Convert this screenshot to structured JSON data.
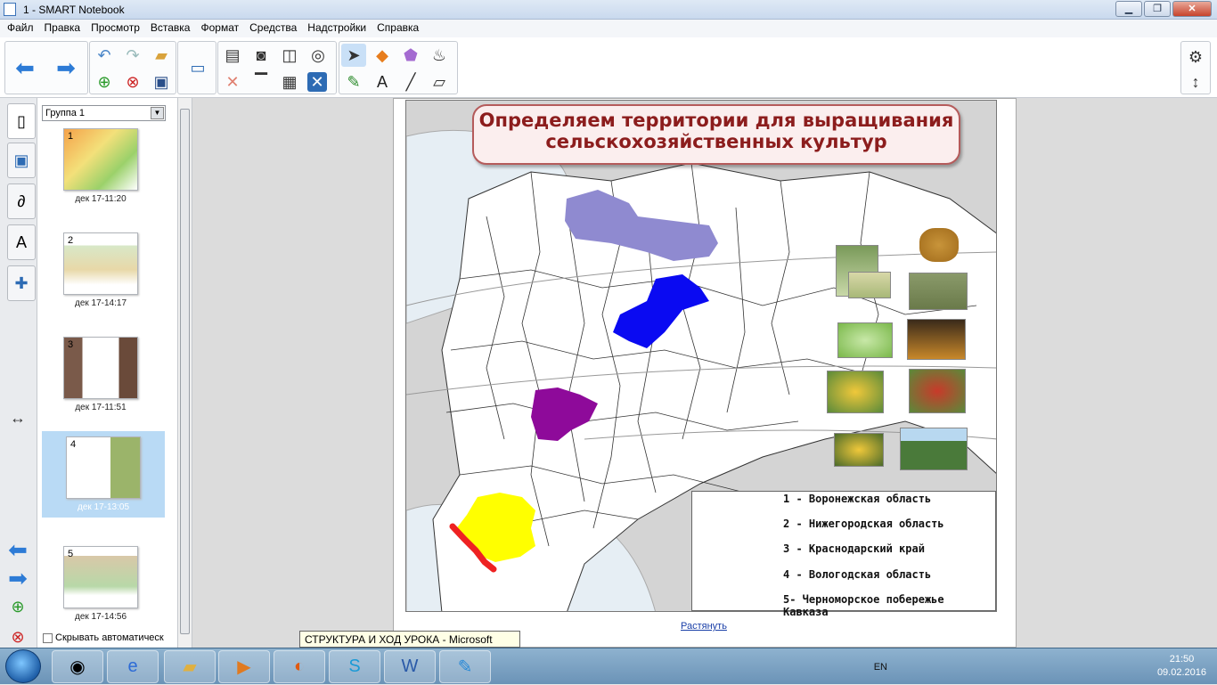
{
  "window": {
    "title": "1 - SMART Notebook",
    "min": "▁",
    "max": "❐",
    "close": "✕"
  },
  "menu": [
    "Файл",
    "Правка",
    "Просмотр",
    "Вставка",
    "Формат",
    "Средства",
    "Надстройки",
    "Справка"
  ],
  "sidebar": {
    "group": "Группа 1",
    "pages": [
      {
        "num": "1",
        "caption": "дек 17-11:20"
      },
      {
        "num": "2",
        "caption": "дек 17-14:17"
      },
      {
        "num": "3",
        "caption": "дек 17-11:51"
      },
      {
        "num": "4",
        "caption": "дек 17-13:05"
      },
      {
        "num": "5",
        "caption": "дек 17-14:56"
      }
    ],
    "hide_auto": "Скрывать автоматическ"
  },
  "slide": {
    "title_line1": "Определяем территории для выращивания",
    "title_line2": "сельскохозяйственных культур",
    "legend": [
      "1 - Воронежская область",
      "2 - Нижегородская область",
      "3 - Краснодарский край",
      "4 - Вологодская область",
      "5- Черноморское побережье Кавказа"
    ],
    "regions": {
      "vologda": "#8f8ad0",
      "nizhny": "#0a0af2",
      "voronezh": "#8e0a9a",
      "krasnodar": "#ffff00",
      "coast": "#ee2222"
    },
    "stretch_link": "Растянуть"
  },
  "tooltip": "СТРУКТУРА И ХОД УРОКА - Microsoft Word",
  "taskbar": {
    "lang": "EN",
    "time": "21:50",
    "date": "09.02.2016"
  }
}
